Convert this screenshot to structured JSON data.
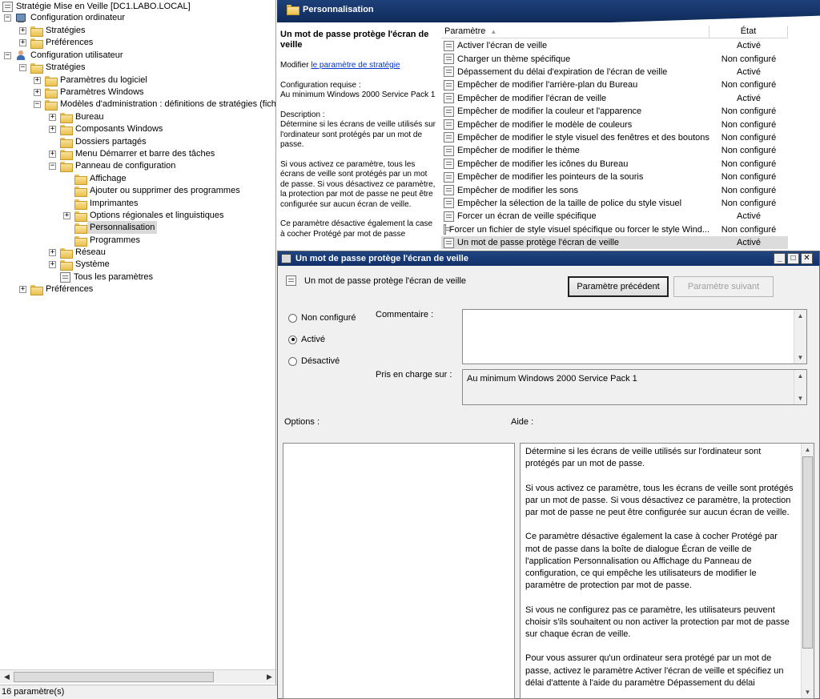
{
  "tree": {
    "root": "Stratégie Mise en Veille [DC1.LABO.LOCAL]",
    "computer_config": "Configuration ordinateur",
    "computer_strategies": "Stratégies",
    "computer_preferences": "Préférences",
    "user_config": "Configuration utilisateur",
    "user_strategies": "Stratégies",
    "software_settings": "Paramètres du logiciel",
    "windows_settings": "Paramètres Windows",
    "admin_templates": "Modèles d'administration : définitions de stratégies (fichie",
    "desktop": "Bureau",
    "windows_components": "Composants Windows",
    "shared_folders": "Dossiers partagés",
    "start_menu": "Menu Démarrer et barre des tâches",
    "control_panel": "Panneau de configuration",
    "display": "Affichage",
    "add_remove": "Ajouter ou supprimer des programmes",
    "printers": "Imprimantes",
    "regional": "Options régionales et linguistiques",
    "personalization": "Personnalisation",
    "programs": "Programmes",
    "network": "Réseau",
    "system": "Système",
    "all_settings": "Tous les paramètres",
    "user_preferences": "Préférences"
  },
  "status": "16 paramètre(s)",
  "header": {
    "title": "Personnalisation"
  },
  "description": {
    "title": "Un mot de passe protège l'écran de veille",
    "modify_prefix": "Modifier ",
    "modify_link": "le paramètre de stratégie",
    "requirements_label": "Configuration requise :",
    "requirements_value": "Au minimum Windows 2000 Service Pack 1",
    "description_label": "Description :",
    "p1": "Détermine si les écrans de veille utilisés sur l'ordinateur sont protégés par un mot de passe.",
    "p2": "Si vous activez ce paramètre, tous les écrans de veille sont protégés par un mot de passe. Si vous désactivez ce paramètre, la protection par mot de passe ne peut être configurée sur aucun écran de veille.",
    "p3": "Ce paramètre désactive également la case à cocher Protégé par mot de passe"
  },
  "list": {
    "col_param": "Paramètre",
    "col_state": "État",
    "rows": [
      {
        "name": "Activer l'écran de veille",
        "state": "Activé"
      },
      {
        "name": "Charger un thème spécifique",
        "state": "Non configuré"
      },
      {
        "name": "Dépassement du délai d'expiration de l'écran de veille",
        "state": "Activé"
      },
      {
        "name": "Empêcher de modifier l'arrière-plan du Bureau",
        "state": "Non configuré"
      },
      {
        "name": "Empêcher de modifier l'écran de veille",
        "state": "Activé"
      },
      {
        "name": "Empêcher de modifier la couleur et l'apparence",
        "state": "Non configuré"
      },
      {
        "name": "Empêcher de modifier le modèle de couleurs",
        "state": "Non configuré"
      },
      {
        "name": "Empêcher de modifier le style visuel des fenêtres et des boutons",
        "state": "Non configuré"
      },
      {
        "name": "Empêcher de modifier le thème",
        "state": "Non configuré"
      },
      {
        "name": "Empêcher de modifier les icônes du Bureau",
        "state": "Non configuré"
      },
      {
        "name": "Empêcher de modifier les pointeurs de la souris",
        "state": "Non configuré"
      },
      {
        "name": "Empêcher de modifier les sons",
        "state": "Non configuré"
      },
      {
        "name": "Empêcher la sélection de la taille de police du style visuel",
        "state": "Non configuré"
      },
      {
        "name": "Forcer un écran de veille spécifique",
        "state": "Activé"
      },
      {
        "name": "Forcer un fichier de style visuel spécifique ou forcer le style Wind...",
        "state": "Non configuré"
      },
      {
        "name": "Un mot de passe protège l'écran de veille",
        "state": "Activé"
      }
    ]
  },
  "dialog": {
    "title": "Un mot de passe protège l'écran de veille",
    "heading": "Un mot de passe protège l'écran de veille",
    "prev_button": "Paramètre précédent",
    "next_button": "Paramètre suivant",
    "radio_not_configured": "Non configuré",
    "radio_enabled": "Activé",
    "radio_disabled": "Désactivé",
    "comment_label": "Commentaire :",
    "supported_label": "Pris en charge sur :",
    "supported_value": "Au minimum Windows 2000 Service Pack 1",
    "options_label": "Options :",
    "help_label": "Aide :",
    "help_p1": "Détermine si les écrans de veille utilisés sur l'ordinateur sont protégés par un mot de passe.",
    "help_p2": "Si vous activez ce paramètre, tous les écrans de veille sont protégés par un mot de passe. Si vous désactivez ce paramètre, la protection par mot de passe ne peut être configurée sur aucun écran de veille.",
    "help_p3": "Ce paramètre désactive également la case à cocher Protégé par mot de passe dans la boîte de dialogue Écran de veille de l'application Personnalisation ou Affichage du Panneau de configuration, ce qui empêche les utilisateurs de modifier le paramètre de protection par mot de passe.",
    "help_p4": "Si vous ne configurez pas ce paramètre, les utilisateurs peuvent choisir s'ils souhaitent ou non activer la protection par mot de passe sur chaque écran de veille.",
    "help_p5": "Pour vous assurer qu'un ordinateur sera protégé par un mot de passe, activez le paramètre Activer l'écran de veille et spécifiez un délai d'attente à l'aide du paramètre Dépassement du délai"
  },
  "colors": {
    "title_bar": "#1e4079",
    "selection": "#dcdcdc",
    "link": "#0033cc"
  }
}
